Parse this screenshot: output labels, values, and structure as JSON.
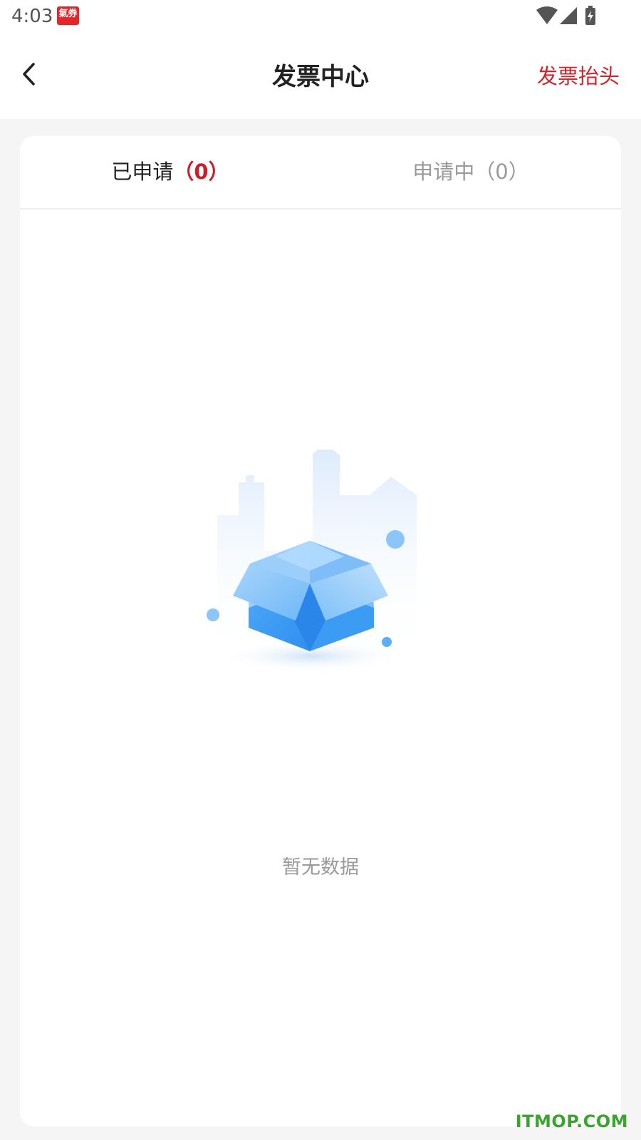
{
  "status_bar": {
    "time": "4:03",
    "app_icon_label": "氣券"
  },
  "header": {
    "title": "发票中心",
    "right_link": "发票抬头",
    "back_icon": "chevron-left-icon"
  },
  "tabs": [
    {
      "label": "已申请",
      "count": "（0）",
      "active": true
    },
    {
      "label": "申请中",
      "count": "（0）",
      "active": false
    }
  ],
  "empty_state": {
    "text": "暂无数据",
    "icon": "empty-box-illustration"
  },
  "watermark": "ITMOP.COM",
  "colors": {
    "accent": "#d0232b",
    "illustration_blue": "#3d9cf4",
    "watermark": "#3aa42e"
  }
}
